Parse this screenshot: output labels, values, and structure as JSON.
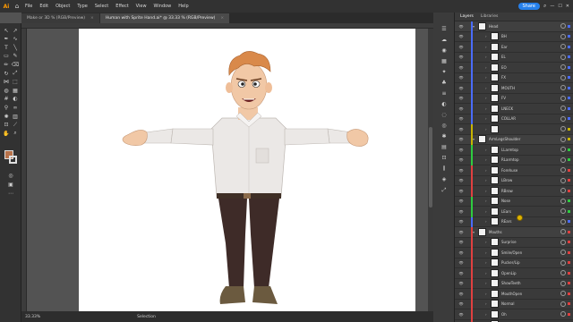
{
  "app": {
    "logo": "Ai"
  },
  "menubar": {
    "items": [
      "File",
      "Edit",
      "Object",
      "Type",
      "Select",
      "Effect",
      "View",
      "Window",
      "Help"
    ],
    "share_label": "Share"
  },
  "tabs": [
    {
      "label": "Make or 3D % (RGB/Preview)",
      "active": false
    },
    {
      "label": "Human with Sprite Hand.ai* @ 33.33 % (RGB/Preview)",
      "active": true
    }
  ],
  "status": {
    "zoom": "33.33%",
    "tool": "Selection"
  },
  "layers_panel": {
    "tabs": [
      "Layers",
      "Libraries"
    ],
    "rows": [
      {
        "name": "Head",
        "indent": 1,
        "group": true,
        "color": "#4a6cff"
      },
      {
        "name": "BH",
        "indent": 2,
        "color": "#4a6cff"
      },
      {
        "name": "Ear",
        "indent": 2,
        "color": "#4a6cff"
      },
      {
        "name": "EL",
        "indent": 2,
        "color": "#4a6cff"
      },
      {
        "name": "EO",
        "indent": 2,
        "color": "#4a6cff"
      },
      {
        "name": "FX",
        "indent": 2,
        "color": "#4a6cff"
      },
      {
        "name": "MOUTH",
        "indent": 2,
        "color": "#4a6cff"
      },
      {
        "name": "FV",
        "indent": 2,
        "color": "#4a6cff"
      },
      {
        "name": "LNECK",
        "indent": 2,
        "color": "#4a6cff"
      },
      {
        "name": "COLLAR",
        "indent": 2,
        "color": "#4a6cff"
      },
      {
        "name": "",
        "indent": 2,
        "color": "#c8b400"
      },
      {
        "name": "ArmLegsShoulder",
        "indent": 1,
        "group": true,
        "color": "#c8b400"
      },
      {
        "name": "LLarmtop",
        "indent": 2,
        "color": "#2ecc40"
      },
      {
        "name": "RLarmtop",
        "indent": 2,
        "color": "#2ecc40"
      },
      {
        "name": "Forehuse",
        "indent": 2,
        "color": "#e04040"
      },
      {
        "name": "LBrow",
        "indent": 2,
        "color": "#e04040"
      },
      {
        "name": "RBrow",
        "indent": 2,
        "color": "#e04040"
      },
      {
        "name": "Nose",
        "indent": 2,
        "color": "#2ecc40"
      },
      {
        "name": "LEars",
        "indent": 2,
        "color": "#2ecc40"
      },
      {
        "name": "REars",
        "indent": 2,
        "color": "#4a6cff"
      },
      {
        "name": "Mouths",
        "indent": 1,
        "group": true,
        "color": "#e04040"
      },
      {
        "name": "Surprise",
        "indent": 2,
        "color": "#e04040"
      },
      {
        "name": "Smile/Open",
        "indent": 2,
        "color": "#e04040"
      },
      {
        "name": "Pucker/Lip",
        "indent": 2,
        "color": "#e04040"
      },
      {
        "name": "OpenLip",
        "indent": 2,
        "color": "#e04040"
      },
      {
        "name": "ShowTeeth",
        "indent": 2,
        "color": "#e04040"
      },
      {
        "name": "MouthOpen",
        "indent": 2,
        "color": "#e04040"
      },
      {
        "name": "Normal",
        "indent": 2,
        "color": "#e04040"
      },
      {
        "name": "Oh",
        "indent": 2,
        "color": "#e04040"
      },
      {
        "name": "Uh",
        "indent": 2,
        "color": "#e04040"
      }
    ]
  },
  "colors": {
    "fill": "#b8724a",
    "accent": "#2680eb"
  },
  "character": {
    "description": "cartoon man in light shirt and dark pants with arms outstretched"
  }
}
